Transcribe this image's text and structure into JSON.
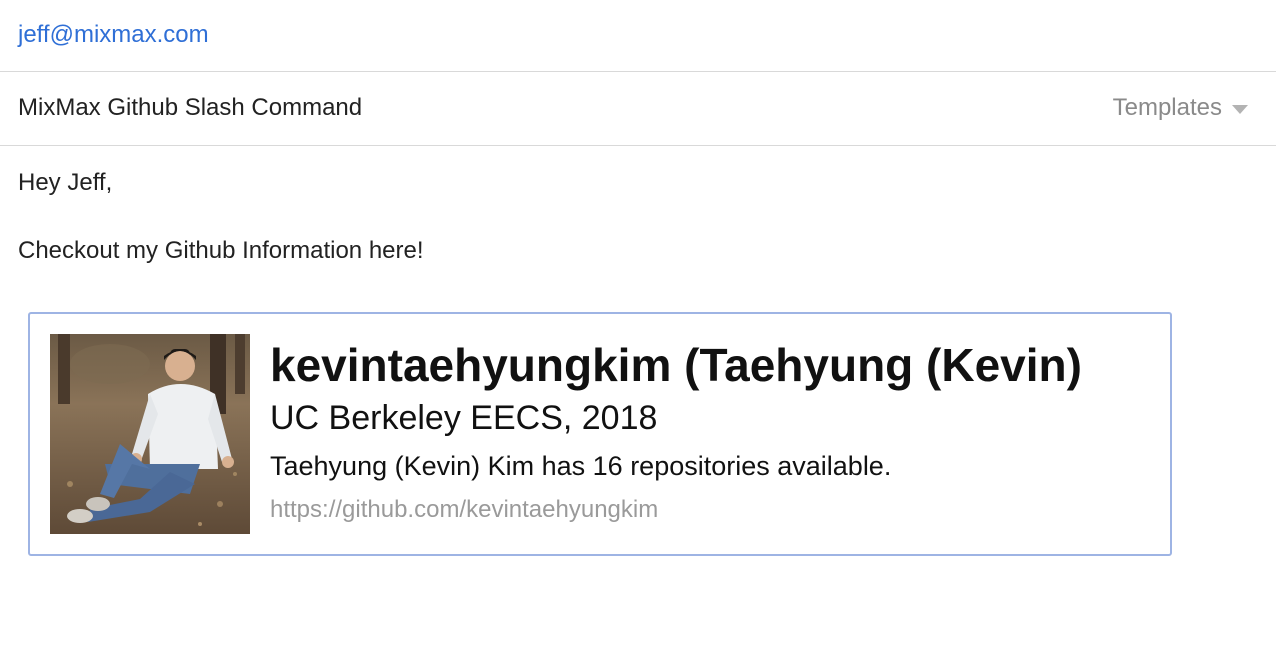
{
  "compose": {
    "to": "jeff@mixmax.com",
    "subject": "MixMax Github Slash Command",
    "templates_label": "Templates",
    "body": {
      "greeting": "Hey Jeff,",
      "message": "Checkout my Github Information here!"
    }
  },
  "github_card": {
    "name": "kevintaehyungkim (Taehyung (Kevin)",
    "bio": "UC Berkeley EECS, 2018",
    "repos_text": "Taehyung (Kevin) Kim has 16 repositories available.",
    "url": "https://github.com/kevintaehyungkim"
  },
  "colors": {
    "recipient": "#2f6fd6",
    "card_border": "#9eb4e4",
    "muted": "#8a8a8a"
  }
}
